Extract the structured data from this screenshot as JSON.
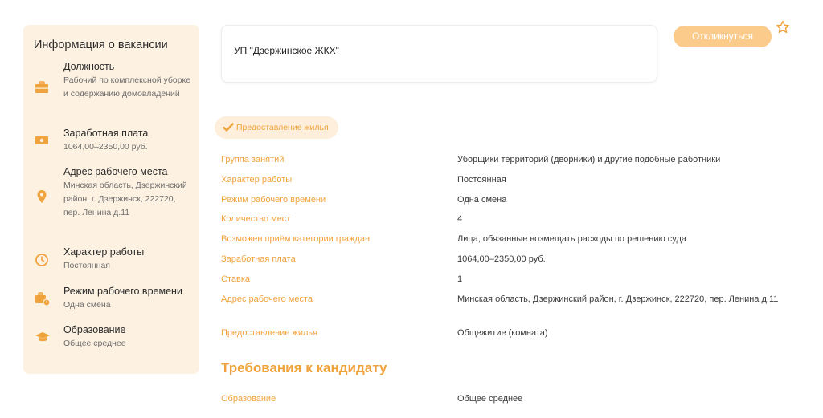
{
  "sidebar": {
    "title": "Информация о вакансии",
    "items": [
      {
        "icon": "briefcase-icon",
        "label": "Должность",
        "value": "Рабочий по комплексной уборке и содержанию домовладений"
      },
      {
        "icon": "money-icon",
        "label": "Заработная плата",
        "value": "1064,00–2350,00 руб."
      },
      {
        "icon": "location-pin-icon",
        "label": "Адрес рабочего места",
        "value": "Минская область, Дзержинский район, г. Дзержинск, 222720, пер. Ленина д.11"
      },
      {
        "icon": "clock-icon",
        "label": "Характер работы",
        "value": "Постоянная"
      },
      {
        "icon": "work-schedule-icon",
        "label": "Режим рабочего времени",
        "value": "Одна смена"
      },
      {
        "icon": "graduation-cap-icon",
        "label": "Образование",
        "value": "Общее среднее"
      }
    ]
  },
  "company": {
    "name": "УП \"Дзержинское ЖКХ\""
  },
  "actions": {
    "apply_label": "Откликнуться"
  },
  "tag": {
    "label": "Предоставление жилья"
  },
  "details": [
    {
      "label": "Группа занятий",
      "value": "Уборщики территорий (дворники) и другие подобные работники"
    },
    {
      "label": "Характер работы",
      "value": "Постоянная"
    },
    {
      "label": "Режим рабочего времени",
      "value": "Одна смена"
    },
    {
      "label": "Количество мест",
      "value": "4"
    },
    {
      "label": "Возможен приём категории граждан",
      "value": "Лица, обязанные возмещать расходы по решению суда"
    },
    {
      "label": "Заработная плата",
      "value": "1064,00–2350,00 руб."
    },
    {
      "label": "Ставка",
      "value": "1"
    },
    {
      "label": "Адрес рабочего места",
      "value": "Минская область, Дзержинский район, г. Дзержинск, 222720, пер. Ленина д.11"
    },
    {
      "label": "Предоставление жилья",
      "value": "Общежитие (комната)"
    }
  ],
  "requirements": {
    "title": "Требования к кандидату",
    "items": [
      {
        "label": "Образование",
        "value": "Общее среднее"
      }
    ]
  },
  "colors": {
    "accent": "#f0a33d",
    "sidebar_bg": "#fdf1e1",
    "button_bg": "#fbcb8c"
  }
}
